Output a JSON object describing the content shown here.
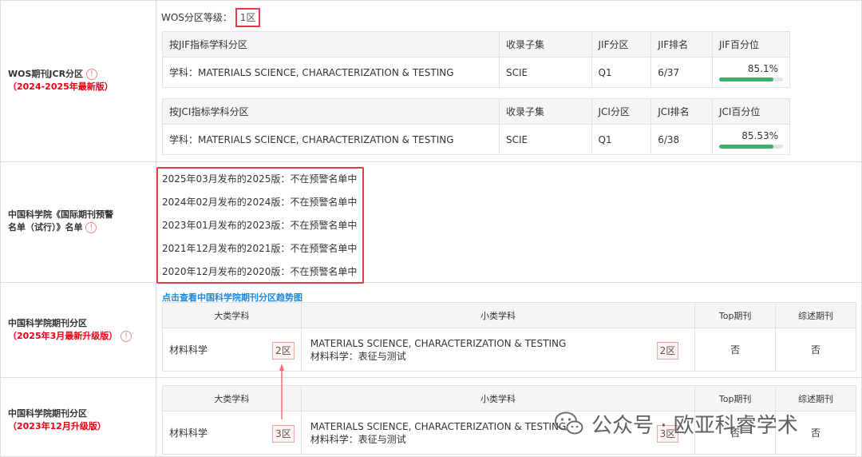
{
  "jcr": {
    "label_line1": "WOS期刊JCR分区",
    "label_line2": "（2024-2025年最新版）",
    "wos_label": "WOS分区等级：",
    "wos_value": "1区",
    "jif_table": {
      "headers": [
        "按JIF指标学科分区",
        "收录子集",
        "JIF分区",
        "JIF排名",
        "JIF百分位"
      ],
      "row": [
        "学科：MATERIALS SCIENCE, CHARACTERIZATION & TESTING",
        "SCIE",
        "Q1",
        "6/37",
        "85.1%"
      ],
      "percentile": 85.1
    },
    "jci_table": {
      "headers": [
        "按JCI指标学科分区",
        "收录子集",
        "JCI分区",
        "JCI排名",
        "JCI百分位"
      ],
      "row": [
        "学科：MATERIALS SCIENCE, CHARACTERIZATION & TESTING",
        "SCIE",
        "Q1",
        "6/38",
        "85.53%"
      ],
      "percentile": 85.53
    }
  },
  "warning": {
    "label_line1": "中国科学院《国际期刊预警",
    "label_line2": "名单（试行）》名单",
    "items": [
      "2025年03月发布的2025版：不在预警名单中",
      "2024年02月发布的2024版：不在预警名单中",
      "2023年01月发布的2023版：不在预警名单中",
      "2021年12月发布的2021版：不在预警名单中",
      "2020年12月发布的2020版：不在预警名单中"
    ]
  },
  "cas2025": {
    "label_line1": "中国科学院期刊分区",
    "label_line2": "（2025年3月最新升级版）",
    "link": "点击查看中国科学院期刊分区趋势图",
    "headers": [
      "大类学科",
      "小类学科",
      "Top期刊",
      "综述期刊"
    ],
    "major": "材料科学",
    "major_zone": "2区",
    "minor_en": "MATERIALS SCIENCE, CHARACTERIZATION & TESTING",
    "minor_cn": "材料科学：表征与测试",
    "minor_zone": "2区",
    "top": "否",
    "review": "否"
  },
  "cas2023": {
    "label_line1": "中国科学院期刊分区",
    "label_line2": "（2023年12月升级版）",
    "headers": [
      "大类学科",
      "小类学科",
      "Top期刊",
      "综述期刊"
    ],
    "major": "材料科学",
    "major_zone": "3区",
    "minor_en": "MATERIALS SCIENCE, CHARACTERIZATION & TESTING",
    "minor_cn": "材料科学：表征与测试",
    "minor_zone": "3区",
    "top": "否",
    "review": "否"
  },
  "info_icon": "!",
  "watermark": "公众号 · 欧亚科睿学术",
  "colors": {
    "accent_red": "#e60012",
    "link_blue": "#1d86d8",
    "bar_green": "#3dae6e",
    "box_red": "#e8384f"
  }
}
